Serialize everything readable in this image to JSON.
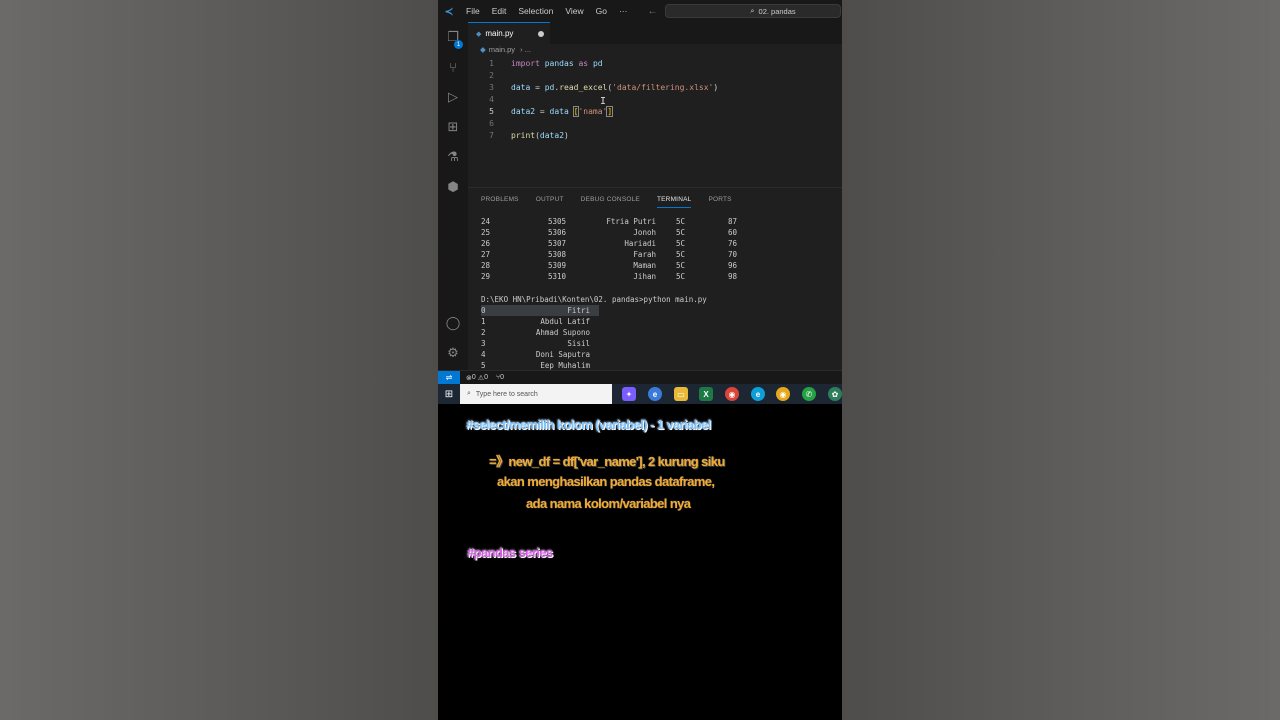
{
  "titlebar": {
    "menus": [
      "File",
      "Edit",
      "Selection",
      "View",
      "Go",
      "···"
    ],
    "search_text": "02. pandas"
  },
  "tab": {
    "label": "main.py"
  },
  "breadcrumb": {
    "file": "main.py",
    "more": "..."
  },
  "editor": {
    "lines": [
      {
        "n": "1",
        "parts": [
          [
            "kw",
            "import"
          ],
          [
            "op",
            " "
          ],
          [
            "var",
            "pandas"
          ],
          [
            "op",
            " "
          ],
          [
            "kw",
            "as"
          ],
          [
            "op",
            " "
          ],
          [
            "var",
            "pd"
          ]
        ]
      },
      {
        "n": "2",
        "parts": []
      },
      {
        "n": "3",
        "parts": [
          [
            "var",
            "data"
          ],
          [
            "op",
            " = "
          ],
          [
            "var",
            "pd"
          ],
          [
            "op",
            "."
          ],
          [
            "fn",
            "read_excel"
          ],
          [
            "op",
            "("
          ],
          [
            "str",
            "'data/filtering.xlsx'"
          ],
          [
            "op",
            ")"
          ]
        ]
      },
      {
        "n": "4",
        "parts": []
      },
      {
        "n": "5",
        "parts": [
          [
            "var",
            "data2"
          ],
          [
            "op",
            " = "
          ],
          [
            "var",
            "data"
          ],
          [
            "op",
            " "
          ],
          [
            "brk",
            "["
          ],
          [
            "str",
            "'nama'"
          ],
          [
            "brk",
            "]"
          ]
        ]
      },
      {
        "n": "6",
        "parts": []
      },
      {
        "n": "7",
        "parts": [
          [
            "fn",
            "print"
          ],
          [
            "op",
            "("
          ],
          [
            "var",
            "data2"
          ],
          [
            "op",
            ")"
          ]
        ]
      }
    ],
    "active_line": "5"
  },
  "panel": {
    "tabs": [
      "PROBLEMS",
      "OUTPUT",
      "DEBUG CONSOLE",
      "TERMINAL",
      "PORTS"
    ],
    "active_tab": "TERMINAL"
  },
  "terminal": {
    "table_rows": [
      [
        "24",
        "5305",
        "Ftria Putri",
        "5C",
        "87"
      ],
      [
        "25",
        "5306",
        "Jonoh",
        "5C",
        "60"
      ],
      [
        "26",
        "5307",
        "Hariadi",
        "5C",
        "76"
      ],
      [
        "27",
        "5308",
        "Farah",
        "5C",
        "70"
      ],
      [
        "28",
        "5309",
        "Maman",
        "5C",
        "96"
      ],
      [
        "29",
        "5310",
        "Jihan",
        "5C",
        "98"
      ]
    ],
    "prompt": "D:\\EKO HN\\Pribadi\\Konten\\02. pandas>python main.py",
    "series_rows": [
      [
        "0",
        "Fitri"
      ],
      [
        "1",
        "Abdul Latif"
      ],
      [
        "2",
        "Ahmad Supono"
      ],
      [
        "3",
        "Sisil"
      ],
      [
        "4",
        "Doni Saputra"
      ],
      [
        "5",
        "Eep Muhalim"
      ]
    ]
  },
  "statusbar": {
    "errors": "0",
    "warnings": "0",
    "ports": "0"
  },
  "taskbar": {
    "search_placeholder": "Type here to search"
  },
  "captions": {
    "line1": "#select/memilih kolom (variabel) - 1 variabel",
    "line2": "=》new_df = df['var_name'], 2 kurung siku",
    "line3": "akan menghasilkan pandas dataframe,",
    "line4": "ada nama kolom/variabel nya",
    "line5": "#pandas series"
  }
}
